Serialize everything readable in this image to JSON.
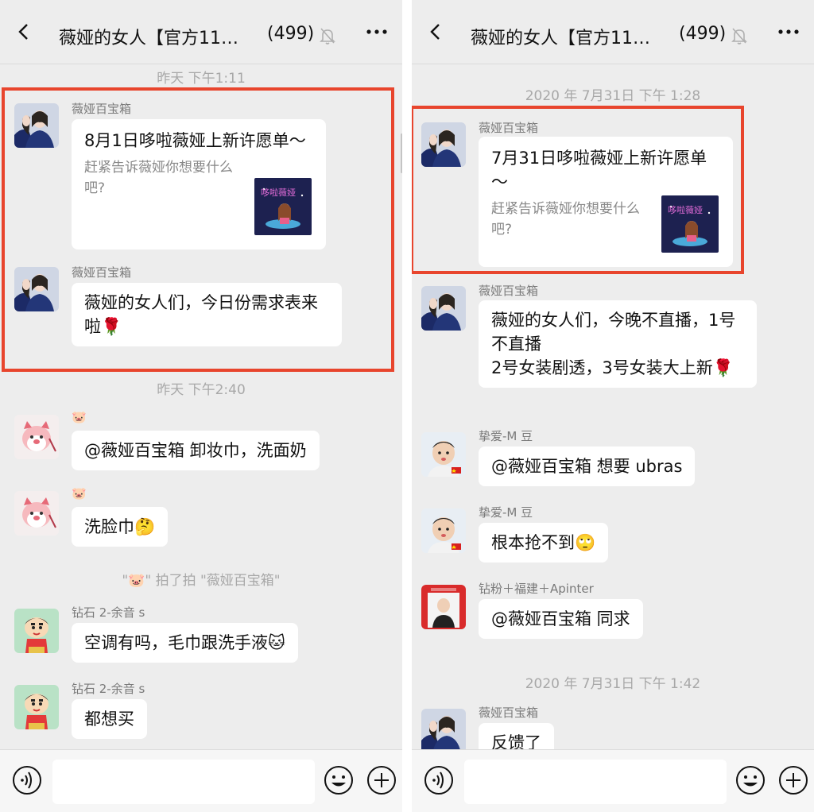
{
  "left": {
    "header": {
      "title": "薇娅的女人【官方11…",
      "count": "(499)"
    },
    "time1": "昨天 下午1:11",
    "msg1": {
      "sender": "薇娅百宝箱",
      "title": "8月1日哆啦薇娅上新许愿单～",
      "desc": "赶紧告诉薇娅你想要什么吧?"
    },
    "msg2": {
      "sender": "薇娅百宝箱",
      "text": "薇娅的女人们，今日份需求表来啦🌹"
    },
    "time2": "昨天 下午2:40",
    "msg3": {
      "sender": "🐷",
      "text": "@薇娅百宝箱 卸妆巾，洗面奶"
    },
    "msg4": {
      "sender": "🐷",
      "text": "洗脸巾🤔"
    },
    "sys": "\"🐷\" 拍了拍 \"薇娅百宝箱\"",
    "msg5": {
      "sender": "钻石 2-余音 s",
      "text": "空调有吗，毛巾跟洗手液🐱"
    },
    "msg6": {
      "sender": "钻石 2-余音 s",
      "text": "都想买"
    }
  },
  "right": {
    "header": {
      "title": "薇娅的女人【官方11…",
      "count": "(499)"
    },
    "time1": "2020 年 7月31日 下午 1:28",
    "msg1": {
      "sender": "薇娅百宝箱",
      "title": "7月31日哆啦薇娅上新许愿单～",
      "desc": "赶紧告诉薇娅你想要什么吧?"
    },
    "msg2": {
      "sender": "薇娅百宝箱",
      "text": "薇娅的女人们，今晚不直播，1号不直播\n2号女装剧透，3号女装大上新🌹"
    },
    "msg3": {
      "sender": "挚爱-M 豆",
      "text": "@薇娅百宝箱 想要 ubras"
    },
    "msg4": {
      "sender": "挚爱-M 豆",
      "text": "根本抢不到🙄"
    },
    "msg5": {
      "sender": "钻粉＋福建＋Apinter",
      "text": "@薇娅百宝箱 同求"
    },
    "time2": "2020 年 7月31日 下午 1:42",
    "msg6": {
      "sender": "薇娅百宝箱",
      "text": "反馈了"
    }
  },
  "colors": {
    "highlight": "#e8452d",
    "background": "#ededed",
    "bubble": "#ffffff"
  }
}
